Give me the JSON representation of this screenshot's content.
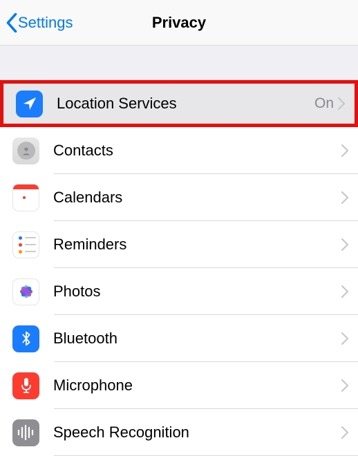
{
  "nav": {
    "back_label": "Settings",
    "title": "Privacy"
  },
  "rows": [
    {
      "key": "location",
      "label": "Location Services",
      "value": "On",
      "highlight": true
    },
    {
      "key": "contacts",
      "label": "Contacts"
    },
    {
      "key": "calendars",
      "label": "Calendars"
    },
    {
      "key": "reminders",
      "label": "Reminders"
    },
    {
      "key": "photos",
      "label": "Photos"
    },
    {
      "key": "bluetooth",
      "label": "Bluetooth"
    },
    {
      "key": "microphone",
      "label": "Microphone"
    },
    {
      "key": "speech",
      "label": "Speech Recognition"
    }
  ]
}
